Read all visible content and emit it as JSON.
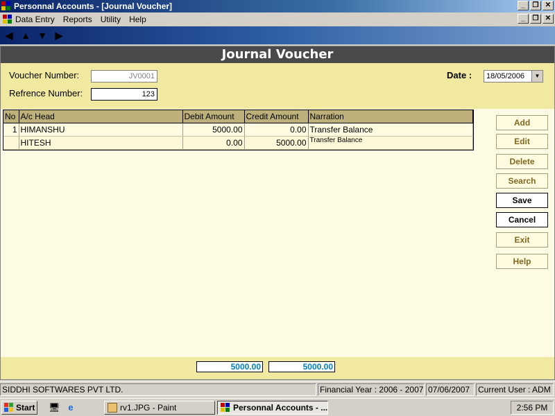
{
  "window": {
    "title": "Personnal Accounts - [Journal Voucher]"
  },
  "menu": {
    "items": [
      "Data Entry",
      "Reports",
      "Utility",
      "Help"
    ]
  },
  "form": {
    "header": "Journal Voucher",
    "voucher_number_label": "Voucher Number:",
    "voucher_number_value": "JV0001",
    "reference_number_label": "Refrence Number:",
    "reference_number_value": "123",
    "date_label": "Date :",
    "date_value": "18/05/2006"
  },
  "grid": {
    "columns": [
      "No",
      "A/c Head",
      "Debit Amount",
      "Credit Amount",
      "Narration"
    ],
    "rows": [
      {
        "no": "1",
        "head": "HIMANSHU",
        "debit": "5000.00",
        "credit": "0.00",
        "narration": "Transfer Balance"
      },
      {
        "no": "",
        "head": "HITESH",
        "debit": "0.00",
        "credit": "5000.00",
        "narration": "Transfer Balance"
      }
    ]
  },
  "buttons": {
    "add": "Add",
    "edit": "Edit",
    "delete": "Delete",
    "search": "Search",
    "save": "Save",
    "cancel": "Cancel",
    "exit": "Exit",
    "help": "Help"
  },
  "totals": {
    "debit": "5000.00",
    "credit": "5000.00"
  },
  "status": {
    "company": "SIDDHI SOFTWARES PVT LTD.",
    "financial_year": "Financial Year : 2006 - 2007",
    "date": "07/06/2007",
    "user": "Current User : ADM"
  },
  "taskbar": {
    "start": "Start",
    "tasks": [
      "rv1.JPG - Paint",
      "Personnal Accounts - ..."
    ],
    "clock": "2:56 PM"
  },
  "colors": {
    "header_bg": "#4a4a4a",
    "panel_bg": "#f1e9a0",
    "grid_header": "#bdb07a",
    "totals_text": "#0080c0"
  }
}
